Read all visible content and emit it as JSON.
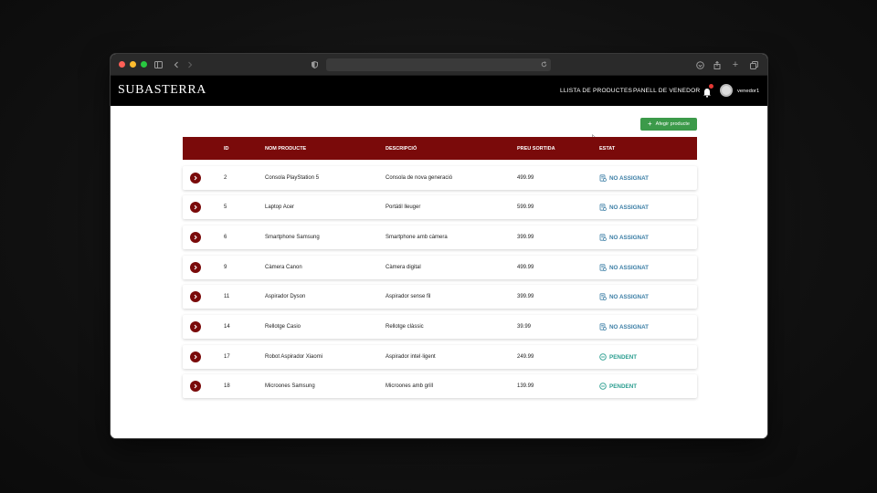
{
  "app": {
    "brand": "Subasterra",
    "nav": {
      "products_link": "LLISTA DE PRODUCTES",
      "seller_panel_link": "PANELL DE VENEDOR"
    },
    "user": {
      "name": "venedor1"
    }
  },
  "actions": {
    "add_product_label": "Afegir producte"
  },
  "table": {
    "headers": {
      "id": "ID",
      "name": "NOM PRODUCTE",
      "description": "DESCRIPCIÓ",
      "price": "PREU SORTIDA",
      "status": "ESTAT"
    },
    "rows": [
      {
        "id": "2",
        "name": "Consola PlayStation 5",
        "description": "Consola de nova generació",
        "price": "499.99",
        "status": "NO ASSIGNAT"
      },
      {
        "id": "5",
        "name": "Laptop Acer",
        "description": "Portàtil lleuger",
        "price": "599.99",
        "status": "NO ASSIGNAT"
      },
      {
        "id": "6",
        "name": "Smartphone Samsung",
        "description": "Smartphone amb càmera",
        "price": "399.99",
        "status": "NO ASSIGNAT"
      },
      {
        "id": "9",
        "name": "Càmera Canon",
        "description": "Càmera digital",
        "price": "499.99",
        "status": "NO ASSIGNAT"
      },
      {
        "id": "11",
        "name": "Aspirador Dyson",
        "description": "Aspirador sense fil",
        "price": "399.99",
        "status": "NO ASSIGNAT"
      },
      {
        "id": "14",
        "name": "Rellotge Casio",
        "description": "Rellotge clàssic",
        "price": "39.99",
        "status": "NO ASSIGNAT"
      },
      {
        "id": "17",
        "name": "Robot Aspirador Xiaomi",
        "description": "Aspirador intel·ligent",
        "price": "249.99",
        "status": "PENDENT"
      },
      {
        "id": "18",
        "name": "Microones Samsung",
        "description": "Microones amb grill",
        "price": "139.99",
        "status": "PENDENT"
      }
    ]
  },
  "colors": {
    "accent": "#7a0a0a",
    "add_button": "#3c9a4a",
    "status_unassigned": "#3d7fa6",
    "status_pending": "#2a9d8f"
  }
}
